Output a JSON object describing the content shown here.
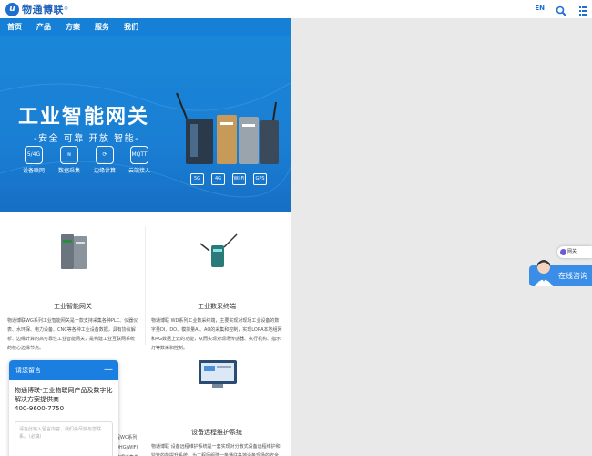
{
  "header": {
    "logo_mark": "u",
    "brand": "物通博联",
    "reg": "®",
    "lang": "EN"
  },
  "nav": [
    "首页",
    "产品",
    "方案",
    "服务",
    "我们"
  ],
  "banner": {
    "title": "工业智能网关",
    "subtitle": "-安全 可靠 开放 智能-",
    "features": [
      {
        "icon": "5/4G",
        "label": "设备联网"
      },
      {
        "icon": "≋",
        "label": "数据采集"
      },
      {
        "icon": "⟳",
        "label": "边缘计算"
      },
      {
        "icon": "MQTT",
        "label": "云端接入"
      }
    ],
    "badges": [
      "5G",
      "4G",
      "Wi-Fi",
      "GPS"
    ],
    "dots": 4,
    "active_dot": 2
  },
  "products": [
    {
      "title": "工业智能网关",
      "desc": "物通博联WG系列工业智能网关是一款支持采集各种PLC、仪器仪表、水环保、电力设备、CNC等各种工业设备数据，具有协议解析、边缘计算的高可靠性工业智能网关，是构建工业互联网系统的核心边缘节点。"
    },
    {
      "title": "工业数采终端",
      "desc": "物通博联 WD系列工业数采终端，主要实现对现场工业设备的数字量DI、DO、模拟量AI、AO的采集和控制，实现LORA本地组网和4G数据上云的功能，从而实现对现场传感器、执行机构、指示灯等数采和控制。"
    },
    {
      "title": "",
      "desc": "程WC系列 OHG/WIFI 数据采集优化 据 转 化"
    },
    {
      "title": "设备远程维护系统",
      "desc": "物通博联 设备远程维护系统是一套实现对分散式设备远程维护和监管的能提升系统。为工程师组建一条通往各地设备现场的安全数据通道，实现对现场设备（PLC）的远程配置、远程诊断、远程升级和远程监控等。"
    }
  ],
  "chat": {
    "header": "请您留言",
    "minimize": "—",
    "company": "物通博联-工业物联网产品及数字化解决方案提供商",
    "phone": "400-9600-7750",
    "placeholder": "请在此输入留言内容，我们会尽快与您联系。（必填）"
  },
  "side": {
    "tag": "网关",
    "consult": "在线咨询"
  },
  "colors": {
    "brand": "#1f6fd0",
    "nav": "#1680d6",
    "banner": "#1a7fd4"
  }
}
